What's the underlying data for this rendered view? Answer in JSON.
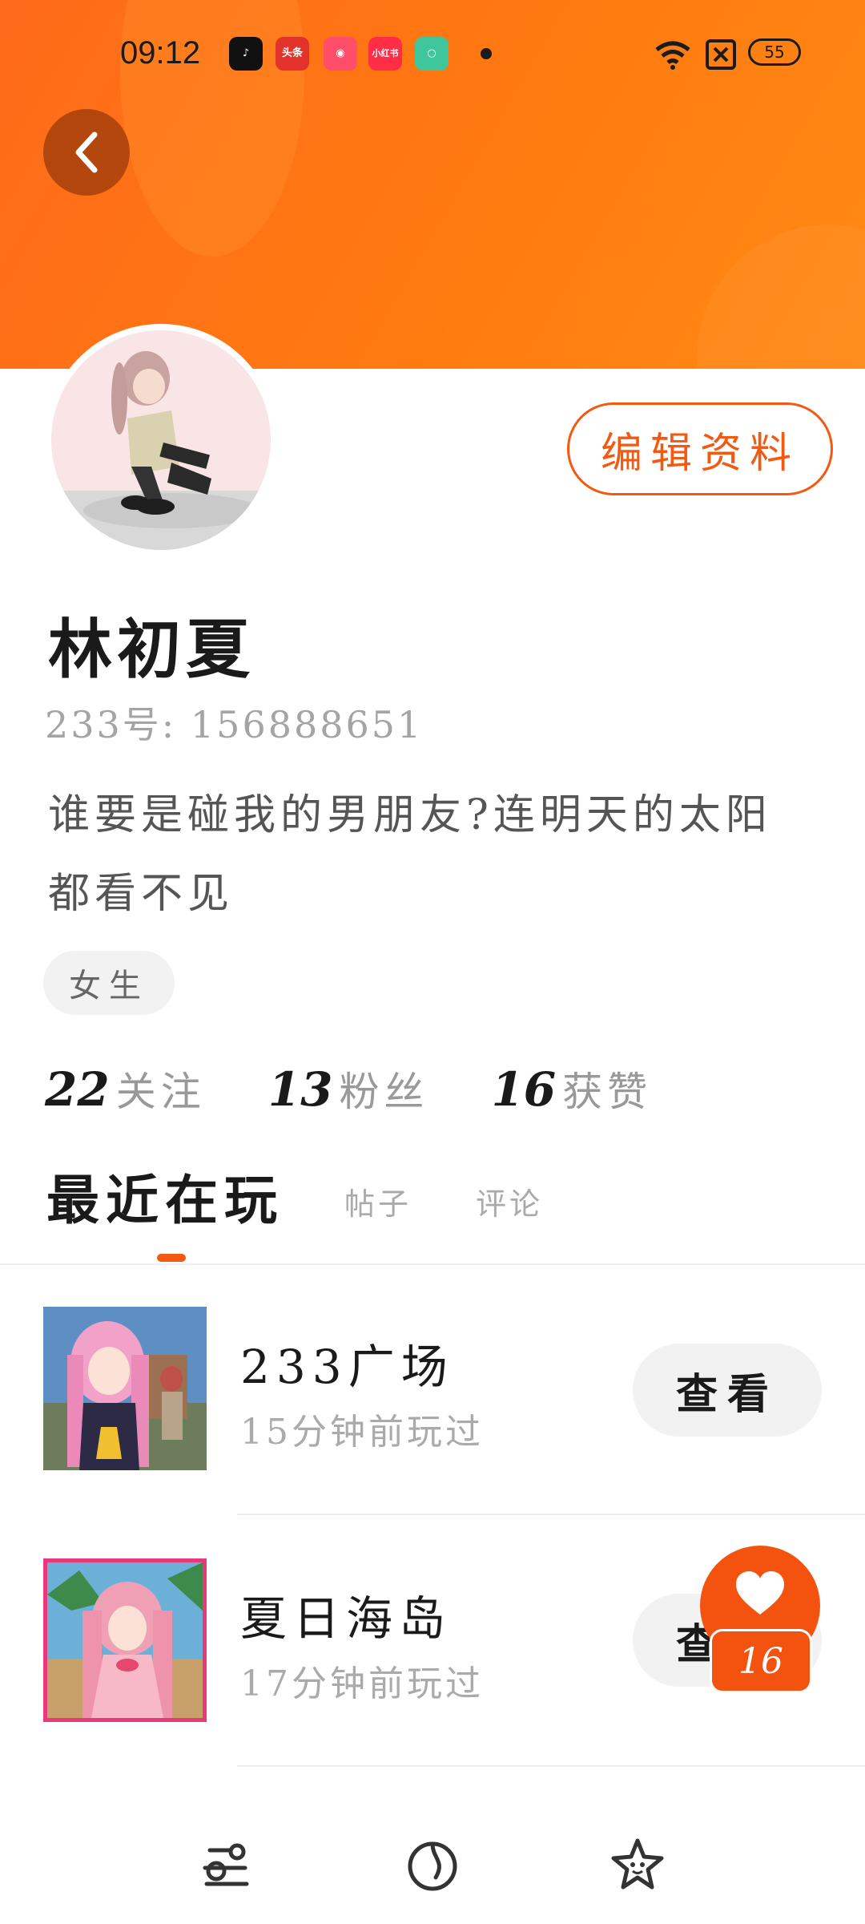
{
  "status_bar": {
    "time": "09:12",
    "apps": [
      "tiktok-icon",
      "toutiao-icon",
      "kuaishou-icon",
      "xiaohongshu-icon",
      "green-app-icon"
    ],
    "app_labels": {
      "toutiao": "头条",
      "kuaishou": "",
      "xhs": "小红书"
    },
    "battery": "55"
  },
  "profile": {
    "edit_label": "编辑资料",
    "name": "林初夏",
    "uid": "233号: 156888651",
    "bio": "谁要是碰我的男朋友?连明天的太阳都看不见",
    "gender": "女生"
  },
  "stats": [
    {
      "count": "22",
      "label": "关注"
    },
    {
      "count": "13",
      "label": "粉丝"
    },
    {
      "count": "16",
      "label": "获赞"
    }
  ],
  "tabs": [
    {
      "label": "最近在玩",
      "active": true
    },
    {
      "label": "帖子",
      "active": false
    },
    {
      "label": "评论",
      "active": false
    }
  ],
  "games": [
    {
      "title": "233广场",
      "last_played": "15分钟前玩过",
      "action": "查看"
    },
    {
      "title": "夏日海岛",
      "last_played": "17分钟前玩过",
      "action": "查看"
    }
  ],
  "like": {
    "count": "16"
  },
  "colors": {
    "accent": "#f25a12",
    "header": "#ff7a10"
  },
  "bottom_nav": [
    "game-controller-icon",
    "discover-icon",
    "star-face-icon"
  ]
}
